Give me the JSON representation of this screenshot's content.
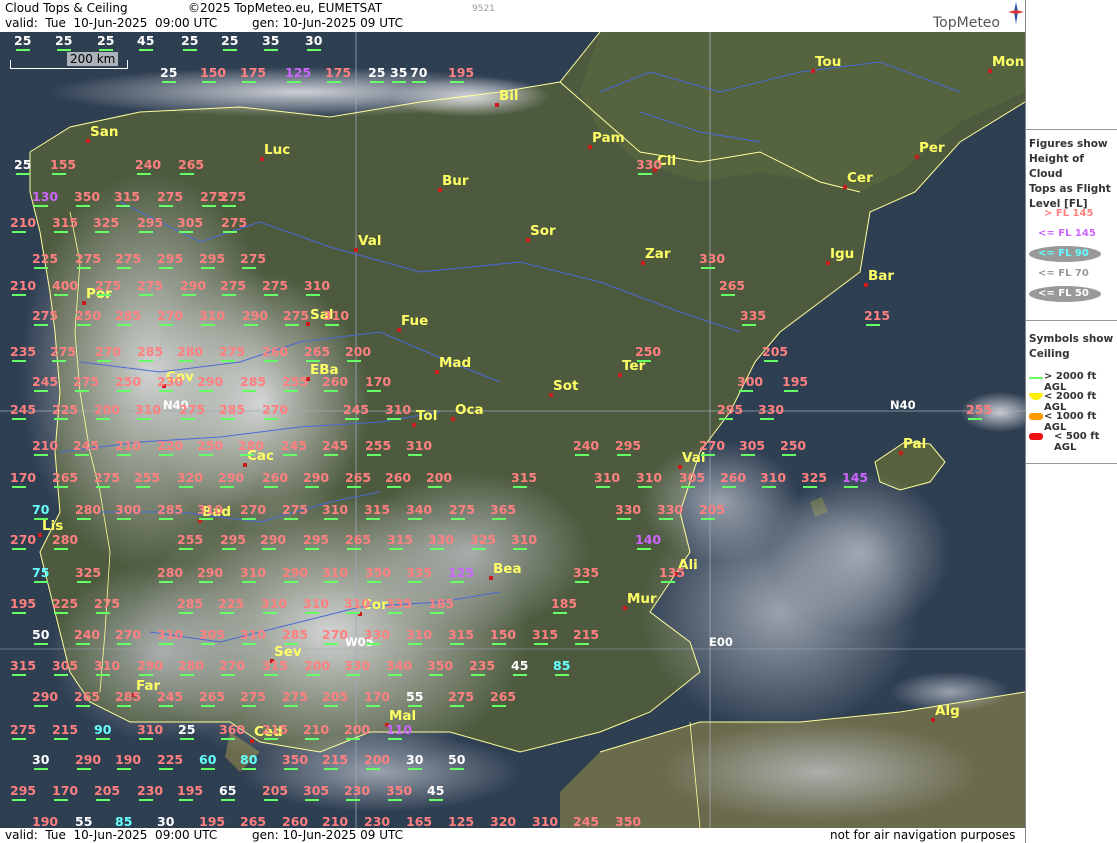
{
  "header": {
    "title": "Cloud Tops & Ceiling",
    "copyright": "©2025 TopMeteo.eu, EUMETSAT",
    "valid": "valid:  Tue  10-Jun-2025  09:00 UTC",
    "gen": "gen: 10-Jun-2025 09 UTC",
    "code": "9521",
    "logo": "TopMeteo"
  },
  "footer": {
    "valid": "valid:  Tue  10-Jun-2025  09:00 UTC",
    "gen": "gen: 10-Jun-2025 09 UTC",
    "disclaimer": "not for air navigation purposes"
  },
  "scale": {
    "label": "200 km"
  },
  "grid_labels": [
    "N40",
    "W05",
    "E00",
    "N40"
  ],
  "legend": {
    "heading": [
      "Figures show",
      "Height of Cloud",
      "Tops as Flight",
      "Level  [FL]"
    ],
    "levels": [
      {
        "label": "> FL 145",
        "color": "#ff8080"
      },
      {
        "label": "<= FL 145",
        "color": "#cc66ff"
      },
      {
        "label": "<= FL 90",
        "color": "#66ffff"
      },
      {
        "label": "<= FL 70",
        "color": "#999999"
      },
      {
        "label": "<= FL 50",
        "color": "#ffffff"
      }
    ],
    "ceiling_heading": [
      "Symbols show",
      "Ceiling"
    ],
    "ceiling": [
      {
        "label": "> 2000 ft AGL",
        "symbol": "line",
        "color": "#66ff66"
      },
      {
        "label": "< 2000 ft AGL",
        "symbol": "half",
        "color": "#ffee00"
      },
      {
        "label": "< 1000 ft AGL",
        "symbol": "bar",
        "color": "#ff9900"
      },
      {
        "label": "< 500 ft AGL",
        "symbol": "bar",
        "color": "#ee1111"
      }
    ]
  },
  "colors": {
    "pink": "#ff8080",
    "purple": "#cc66ff",
    "cyan": "#66ffff",
    "white": "#ffffff",
    "yellow": "#ffff66",
    "green": "#66ff66",
    "orange": "#ff9900",
    "red": "#ee1111",
    "ceilyellow": "#ffee00"
  },
  "cities": [
    "Tou",
    "Mon",
    "Bil",
    "San",
    "Luc",
    "Pam",
    "Cil",
    "Per",
    "Cer",
    "Bur",
    "Sor",
    "Val",
    "Zar",
    "Igu",
    "Bar",
    "Por",
    "Sal",
    "Fue",
    "Mad",
    "Ter",
    "Sot",
    "Cov",
    "EBa",
    "Tol",
    "Oca",
    "Pal",
    "Cac",
    "Val",
    "Bad",
    "Lis",
    "Bea",
    "Ali",
    "Mur",
    "Cor",
    "Sev",
    "Far",
    "Mal",
    "Ced",
    "Alg"
  ],
  "labels": [
    {
      "v": "25",
      "c": "white"
    },
    {
      "v": "25",
      "c": "white"
    },
    {
      "v": "25",
      "c": "white"
    },
    {
      "v": "45",
      "c": "white"
    },
    {
      "v": "25",
      "c": "white"
    },
    {
      "v": "25",
      "c": "white"
    },
    {
      "v": "35",
      "c": "white"
    },
    {
      "v": "30",
      "c": "white"
    },
    {
      "v": "25",
      "c": "white"
    },
    {
      "v": "150",
      "c": "pink"
    },
    {
      "v": "175",
      "c": "pink"
    },
    {
      "v": "125",
      "c": "purple"
    },
    {
      "v": "175",
      "c": "pink"
    },
    {
      "v": "25",
      "c": "white"
    },
    {
      "v": "70",
      "c": "white"
    },
    {
      "v": "195",
      "c": "pink"
    },
    {
      "v": "35",
      "c": "white"
    },
    {
      "v": "25",
      "c": "white"
    },
    {
      "v": "155",
      "c": "pink"
    },
    {
      "v": "240",
      "c": "pink"
    },
    {
      "v": "265",
      "c": "pink"
    },
    {
      "v": "330",
      "c": "pink"
    },
    {
      "v": "130",
      "c": "purple"
    },
    {
      "v": "350",
      "c": "pink"
    },
    {
      "v": "315",
      "c": "pink"
    },
    {
      "v": "275",
      "c": "pink"
    },
    {
      "v": "275",
      "c": "pink"
    },
    {
      "v": "275",
      "c": "pink"
    },
    {
      "v": "210",
      "c": "pink"
    },
    {
      "v": "315",
      "c": "pink"
    },
    {
      "v": "325",
      "c": "pink"
    },
    {
      "v": "295",
      "c": "pink"
    },
    {
      "v": "305",
      "c": "pink"
    },
    {
      "v": "275",
      "c": "pink"
    },
    {
      "v": "225",
      "c": "pink"
    },
    {
      "v": "275",
      "c": "pink"
    },
    {
      "v": "275",
      "c": "pink"
    },
    {
      "v": "295",
      "c": "pink"
    },
    {
      "v": "295",
      "c": "pink"
    },
    {
      "v": "275",
      "c": "pink"
    },
    {
      "v": "330",
      "c": "pink"
    },
    {
      "v": "210",
      "c": "pink"
    },
    {
      "v": "400",
      "c": "pink"
    },
    {
      "v": "275",
      "c": "pink"
    },
    {
      "v": "275",
      "c": "pink"
    },
    {
      "v": "290",
      "c": "pink"
    },
    {
      "v": "275",
      "c": "pink"
    },
    {
      "v": "275",
      "c": "pink"
    },
    {
      "v": "310",
      "c": "pink"
    },
    {
      "v": "265",
      "c": "pink"
    },
    {
      "v": "275",
      "c": "pink"
    },
    {
      "v": "250",
      "c": "pink"
    },
    {
      "v": "285",
      "c": "pink"
    },
    {
      "v": "270",
      "c": "pink"
    },
    {
      "v": "310",
      "c": "pink"
    },
    {
      "v": "290",
      "c": "pink"
    },
    {
      "v": "275",
      "c": "pink"
    },
    {
      "v": "310",
      "c": "pink"
    },
    {
      "v": "335",
      "c": "pink"
    },
    {
      "v": "215",
      "c": "pink"
    },
    {
      "v": "235",
      "c": "pink"
    },
    {
      "v": "275",
      "c": "pink"
    },
    {
      "v": "270",
      "c": "pink"
    },
    {
      "v": "285",
      "c": "pink"
    },
    {
      "v": "280",
      "c": "pink"
    },
    {
      "v": "275",
      "c": "pink"
    },
    {
      "v": "260",
      "c": "pink"
    },
    {
      "v": "265",
      "c": "pink"
    },
    {
      "v": "200",
      "c": "pink"
    },
    {
      "v": "250",
      "c": "pink"
    },
    {
      "v": "205",
      "c": "pink"
    },
    {
      "v": "245",
      "c": "pink"
    },
    {
      "v": "275",
      "c": "pink"
    },
    {
      "v": "250",
      "c": "pink"
    },
    {
      "v": "230",
      "c": "pink"
    },
    {
      "v": "290",
      "c": "pink"
    },
    {
      "v": "285",
      "c": "pink"
    },
    {
      "v": "255",
      "c": "pink"
    },
    {
      "v": "260",
      "c": "pink"
    },
    {
      "v": "170",
      "c": "pink"
    },
    {
      "v": "300",
      "c": "pink"
    },
    {
      "v": "195",
      "c": "pink"
    },
    {
      "v": "245",
      "c": "pink"
    },
    {
      "v": "225",
      "c": "pink"
    },
    {
      "v": "200",
      "c": "pink"
    },
    {
      "v": "310",
      "c": "pink"
    },
    {
      "v": "275",
      "c": "pink"
    },
    {
      "v": "285",
      "c": "pink"
    },
    {
      "v": "270",
      "c": "pink"
    },
    {
      "v": "245",
      "c": "pink"
    },
    {
      "v": "310",
      "c": "pink"
    },
    {
      "v": "295",
      "c": "pink"
    },
    {
      "v": "330",
      "c": "pink"
    },
    {
      "v": "255",
      "c": "pink"
    },
    {
      "v": "210",
      "c": "pink"
    },
    {
      "v": "245",
      "c": "pink"
    },
    {
      "v": "210",
      "c": "pink"
    },
    {
      "v": "220",
      "c": "pink"
    },
    {
      "v": "250",
      "c": "pink"
    },
    {
      "v": "280",
      "c": "pink"
    },
    {
      "v": "245",
      "c": "pink"
    },
    {
      "v": "245",
      "c": "pink"
    },
    {
      "v": "255",
      "c": "pink"
    },
    {
      "v": "310",
      "c": "pink"
    },
    {
      "v": "240",
      "c": "pink"
    },
    {
      "v": "295",
      "c": "pink"
    },
    {
      "v": "270",
      "c": "pink"
    },
    {
      "v": "305",
      "c": "pink"
    },
    {
      "v": "250",
      "c": "pink"
    },
    {
      "v": "170",
      "c": "pink"
    },
    {
      "v": "265",
      "c": "pink"
    },
    {
      "v": "275",
      "c": "pink"
    },
    {
      "v": "255",
      "c": "pink"
    },
    {
      "v": "320",
      "c": "pink"
    },
    {
      "v": "290",
      "c": "pink"
    },
    {
      "v": "260",
      "c": "pink"
    },
    {
      "v": "290",
      "c": "pink"
    },
    {
      "v": "265",
      "c": "pink"
    },
    {
      "v": "260",
      "c": "pink"
    },
    {
      "v": "200",
      "c": "pink"
    },
    {
      "v": "315",
      "c": "pink"
    },
    {
      "v": "310",
      "c": "pink"
    },
    {
      "v": "310",
      "c": "pink"
    },
    {
      "v": "305",
      "c": "pink"
    },
    {
      "v": "260",
      "c": "pink"
    },
    {
      "v": "310",
      "c": "pink"
    },
    {
      "v": "325",
      "c": "pink"
    },
    {
      "v": "145",
      "c": "purple"
    },
    {
      "v": "70",
      "c": "cyan"
    },
    {
      "v": "280",
      "c": "pink"
    },
    {
      "v": "300",
      "c": "pink"
    },
    {
      "v": "285",
      "c": "pink"
    },
    {
      "v": "310",
      "c": "pink"
    },
    {
      "v": "270",
      "c": "pink"
    },
    {
      "v": "275",
      "c": "pink"
    },
    {
      "v": "310",
      "c": "pink"
    },
    {
      "v": "315",
      "c": "pink"
    },
    {
      "v": "340",
      "c": "pink"
    },
    {
      "v": "275",
      "c": "pink"
    },
    {
      "v": "365",
      "c": "pink"
    },
    {
      "v": "330",
      "c": "pink"
    },
    {
      "v": "330",
      "c": "pink"
    },
    {
      "v": "205",
      "c": "pink"
    },
    {
      "v": "270",
      "c": "pink"
    },
    {
      "v": "280",
      "c": "pink"
    },
    {
      "v": "255",
      "c": "pink"
    },
    {
      "v": "295",
      "c": "pink"
    },
    {
      "v": "290",
      "c": "pink"
    },
    {
      "v": "295",
      "c": "pink"
    },
    {
      "v": "265",
      "c": "pink"
    },
    {
      "v": "315",
      "c": "pink"
    },
    {
      "v": "330",
      "c": "pink"
    },
    {
      "v": "325",
      "c": "pink"
    },
    {
      "v": "310",
      "c": "pink"
    },
    {
      "v": "140",
      "c": "purple"
    },
    {
      "v": "75",
      "c": "cyan"
    },
    {
      "v": "325",
      "c": "pink"
    },
    {
      "v": "280",
      "c": "pink"
    },
    {
      "v": "290",
      "c": "pink"
    },
    {
      "v": "310",
      "c": "pink"
    },
    {
      "v": "290",
      "c": "pink"
    },
    {
      "v": "310",
      "c": "pink"
    },
    {
      "v": "350",
      "c": "pink"
    },
    {
      "v": "335",
      "c": "pink"
    },
    {
      "v": "125",
      "c": "purple"
    },
    {
      "v": "335",
      "c": "pink"
    },
    {
      "v": "135",
      "c": "pink"
    },
    {
      "v": "195",
      "c": "pink"
    },
    {
      "v": "225",
      "c": "pink"
    },
    {
      "v": "275",
      "c": "pink"
    },
    {
      "v": "285",
      "c": "pink"
    },
    {
      "v": "225",
      "c": "pink"
    },
    {
      "v": "310",
      "c": "pink"
    },
    {
      "v": "310",
      "c": "pink"
    },
    {
      "v": "310",
      "c": "pink"
    },
    {
      "v": "335",
      "c": "pink"
    },
    {
      "v": "185",
      "c": "pink"
    },
    {
      "v": "185",
      "c": "pink"
    },
    {
      "v": "50",
      "c": "white"
    },
    {
      "v": "240",
      "c": "pink"
    },
    {
      "v": "270",
      "c": "pink"
    },
    {
      "v": "310",
      "c": "pink"
    },
    {
      "v": "305",
      "c": "pink"
    },
    {
      "v": "310",
      "c": "pink"
    },
    {
      "v": "285",
      "c": "pink"
    },
    {
      "v": "270",
      "c": "pink"
    },
    {
      "v": "330",
      "c": "pink"
    },
    {
      "v": "310",
      "c": "pink"
    },
    {
      "v": "315",
      "c": "pink"
    },
    {
      "v": "150",
      "c": "pink"
    },
    {
      "v": "315",
      "c": "pink"
    },
    {
      "v": "215",
      "c": "pink"
    },
    {
      "v": "315",
      "c": "pink"
    },
    {
      "v": "305",
      "c": "pink"
    },
    {
      "v": "310",
      "c": "pink"
    },
    {
      "v": "290",
      "c": "pink"
    },
    {
      "v": "280",
      "c": "pink"
    },
    {
      "v": "270",
      "c": "pink"
    },
    {
      "v": "315",
      "c": "pink"
    },
    {
      "v": "200",
      "c": "pink"
    },
    {
      "v": "330",
      "c": "pink"
    },
    {
      "v": "340",
      "c": "pink"
    },
    {
      "v": "350",
      "c": "pink"
    },
    {
      "v": "235",
      "c": "pink"
    },
    {
      "v": "45",
      "c": "white"
    },
    {
      "v": "85",
      "c": "cyan"
    },
    {
      "v": "290",
      "c": "pink"
    },
    {
      "v": "265",
      "c": "pink"
    },
    {
      "v": "285",
      "c": "pink"
    },
    {
      "v": "245",
      "c": "pink"
    },
    {
      "v": "265",
      "c": "pink"
    },
    {
      "v": "275",
      "c": "pink"
    },
    {
      "v": "275",
      "c": "pink"
    },
    {
      "v": "205",
      "c": "pink"
    },
    {
      "v": "170",
      "c": "pink"
    },
    {
      "v": "55",
      "c": "white"
    },
    {
      "v": "275",
      "c": "pink"
    },
    {
      "v": "265",
      "c": "pink"
    },
    {
      "v": "275",
      "c": "pink"
    },
    {
      "v": "215",
      "c": "pink"
    },
    {
      "v": "90",
      "c": "cyan"
    },
    {
      "v": "310",
      "c": "pink"
    },
    {
      "v": "25",
      "c": "white"
    },
    {
      "v": "360",
      "c": "pink"
    },
    {
      "v": "215",
      "c": "pink"
    },
    {
      "v": "210",
      "c": "pink"
    },
    {
      "v": "200",
      "c": "pink"
    },
    {
      "v": "110",
      "c": "purple"
    },
    {
      "v": "30",
      "c": "white"
    },
    {
      "v": "290",
      "c": "pink"
    },
    {
      "v": "190",
      "c": "pink"
    },
    {
      "v": "225",
      "c": "pink"
    },
    {
      "v": "60",
      "c": "cyan"
    },
    {
      "v": "80",
      "c": "cyan"
    },
    {
      "v": "350",
      "c": "pink"
    },
    {
      "v": "215",
      "c": "pink"
    },
    {
      "v": "200",
      "c": "pink"
    },
    {
      "v": "30",
      "c": "white"
    },
    {
      "v": "50",
      "c": "white"
    },
    {
      "v": "295",
      "c": "pink"
    },
    {
      "v": "170",
      "c": "pink"
    },
    {
      "v": "205",
      "c": "pink"
    },
    {
      "v": "230",
      "c": "pink"
    },
    {
      "v": "195",
      "c": "pink"
    },
    {
      "v": "65",
      "c": "white"
    },
    {
      "v": "205",
      "c": "pink"
    },
    {
      "v": "305",
      "c": "pink"
    },
    {
      "v": "230",
      "c": "pink"
    },
    {
      "v": "350",
      "c": "pink"
    },
    {
      "v": "45",
      "c": "white"
    },
    {
      "v": "190",
      "c": "pink"
    },
    {
      "v": "55",
      "c": "white"
    },
    {
      "v": "85",
      "c": "cyan"
    },
    {
      "v": "30",
      "c": "white"
    },
    {
      "v": "195",
      "c": "pink"
    },
    {
      "v": "265",
      "c": "pink"
    },
    {
      "v": "260",
      "c": "pink"
    },
    {
      "v": "210",
      "c": "pink"
    },
    {
      "v": "230",
      "c": "pink"
    },
    {
      "v": "165",
      "c": "pink"
    },
    {
      "v": "125",
      "c": "pink"
    },
    {
      "v": "320",
      "c": "pink"
    },
    {
      "v": "310",
      "c": "pink"
    },
    {
      "v": "245",
      "c": "pink"
    },
    {
      "v": "350",
      "c": "pink"
    }
  ]
}
